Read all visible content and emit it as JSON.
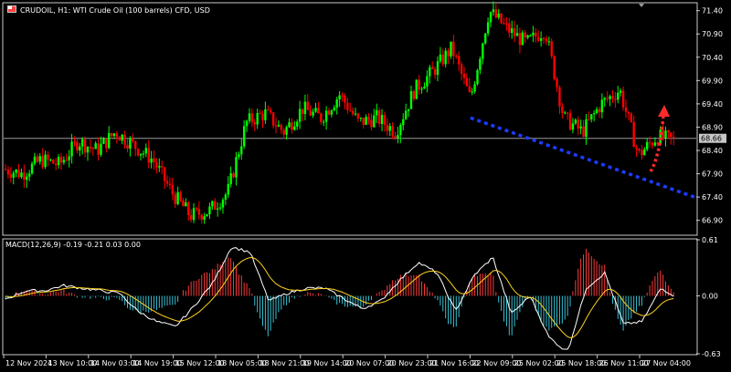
{
  "header": {
    "title": "CRUDOIL, H1:  WTI Crude Oil (100 barrels) CFD, USD",
    "chart_icon": "chart-window-icon"
  },
  "price_axis": {
    "ticks": [
      "71.40",
      "70.90",
      "70.40",
      "69.90",
      "69.40",
      "68.90",
      "68.40",
      "67.90",
      "67.40",
      "66.90"
    ],
    "current_price": "68.66"
  },
  "macd": {
    "label": "MACD(12,26,9) -0.19 -0.21 0.03 0.00",
    "ticks": [
      "0.61",
      "0.00",
      "-0.63"
    ]
  },
  "time_axis": {
    "labels": [
      "12 Nov 2024",
      "13 Nov 10:00",
      "14 Nov 03:00",
      "14 Nov 19:00",
      "15 Nov 12:00",
      "18 Nov 05:00",
      "18 Nov 21:00",
      "19 Nov 14:00",
      "20 Nov 07:00",
      "20 Nov 23:00",
      "21 Nov 16:00",
      "22 Nov 09:00",
      "25 Nov 02:00",
      "25 Nov 18:00",
      "26 Nov 11:00",
      "27 Nov 04:00"
    ]
  },
  "colors": {
    "bull": "#00ff00",
    "bear": "#ff0000",
    "trendline": "#1e3cff",
    "forecast_arrow": "#ff2a2a",
    "macd_pos": "#ff3a3a",
    "macd_neg": "#36c2d6",
    "macd_line": "#ffffff",
    "signal_line": "#ffd21e"
  },
  "chart_data": {
    "type": "candlestick",
    "symbol": "CRUDOIL",
    "timeframe": "H1",
    "ylim": [
      66.6,
      71.55
    ],
    "current_price": 68.66,
    "path_points": [
      {
        "x": 0,
        "y": 68.0
      },
      {
        "x": 5,
        "y": 67.9
      },
      {
        "x": 10,
        "y": 68.2
      },
      {
        "x": 15,
        "y": 68.1
      },
      {
        "x": 20,
        "y": 68.6
      },
      {
        "x": 25,
        "y": 68.4
      },
      {
        "x": 30,
        "y": 68.8
      },
      {
        "x": 35,
        "y": 68.5
      },
      {
        "x": 40,
        "y": 68.2
      },
      {
        "x": 45,
        "y": 67.5
      },
      {
        "x": 50,
        "y": 67.0
      },
      {
        "x": 55,
        "y": 67.1
      },
      {
        "x": 60,
        "y": 67.5
      },
      {
        "x": 65,
        "y": 69.0
      },
      {
        "x": 70,
        "y": 69.2
      },
      {
        "x": 75,
        "y": 68.8
      },
      {
        "x": 80,
        "y": 69.3
      },
      {
        "x": 85,
        "y": 69.1
      },
      {
        "x": 90,
        "y": 69.6
      },
      {
        "x": 95,
        "y": 69.0
      },
      {
        "x": 100,
        "y": 69.1
      },
      {
        "x": 105,
        "y": 68.8
      },
      {
        "x": 110,
        "y": 69.7
      },
      {
        "x": 115,
        "y": 70.1
      },
      {
        "x": 120,
        "y": 70.6
      },
      {
        "x": 125,
        "y": 69.5
      },
      {
        "x": 130,
        "y": 71.4
      },
      {
        "x": 135,
        "y": 71.0
      },
      {
        "x": 140,
        "y": 70.7
      },
      {
        "x": 145,
        "y": 71.0
      },
      {
        "x": 150,
        "y": 69.1
      },
      {
        "x": 155,
        "y": 68.8
      },
      {
        "x": 160,
        "y": 69.4
      },
      {
        "x": 165,
        "y": 69.7
      },
      {
        "x": 170,
        "y": 68.3
      },
      {
        "x": 175,
        "y": 68.7
      },
      {
        "x": 180,
        "y": 68.6
      }
    ],
    "trendline": {
      "start": {
        "x": 125,
        "y": 69.1
      },
      "end": {
        "x": 185,
        "y": 67.4
      }
    },
    "macd": {
      "fast": 12,
      "slow": 26,
      "signal": 9,
      "values": [
        -0.19,
        -0.21,
        0.03,
        0.0
      ],
      "ylim": [
        -0.63,
        0.61
      ]
    }
  }
}
